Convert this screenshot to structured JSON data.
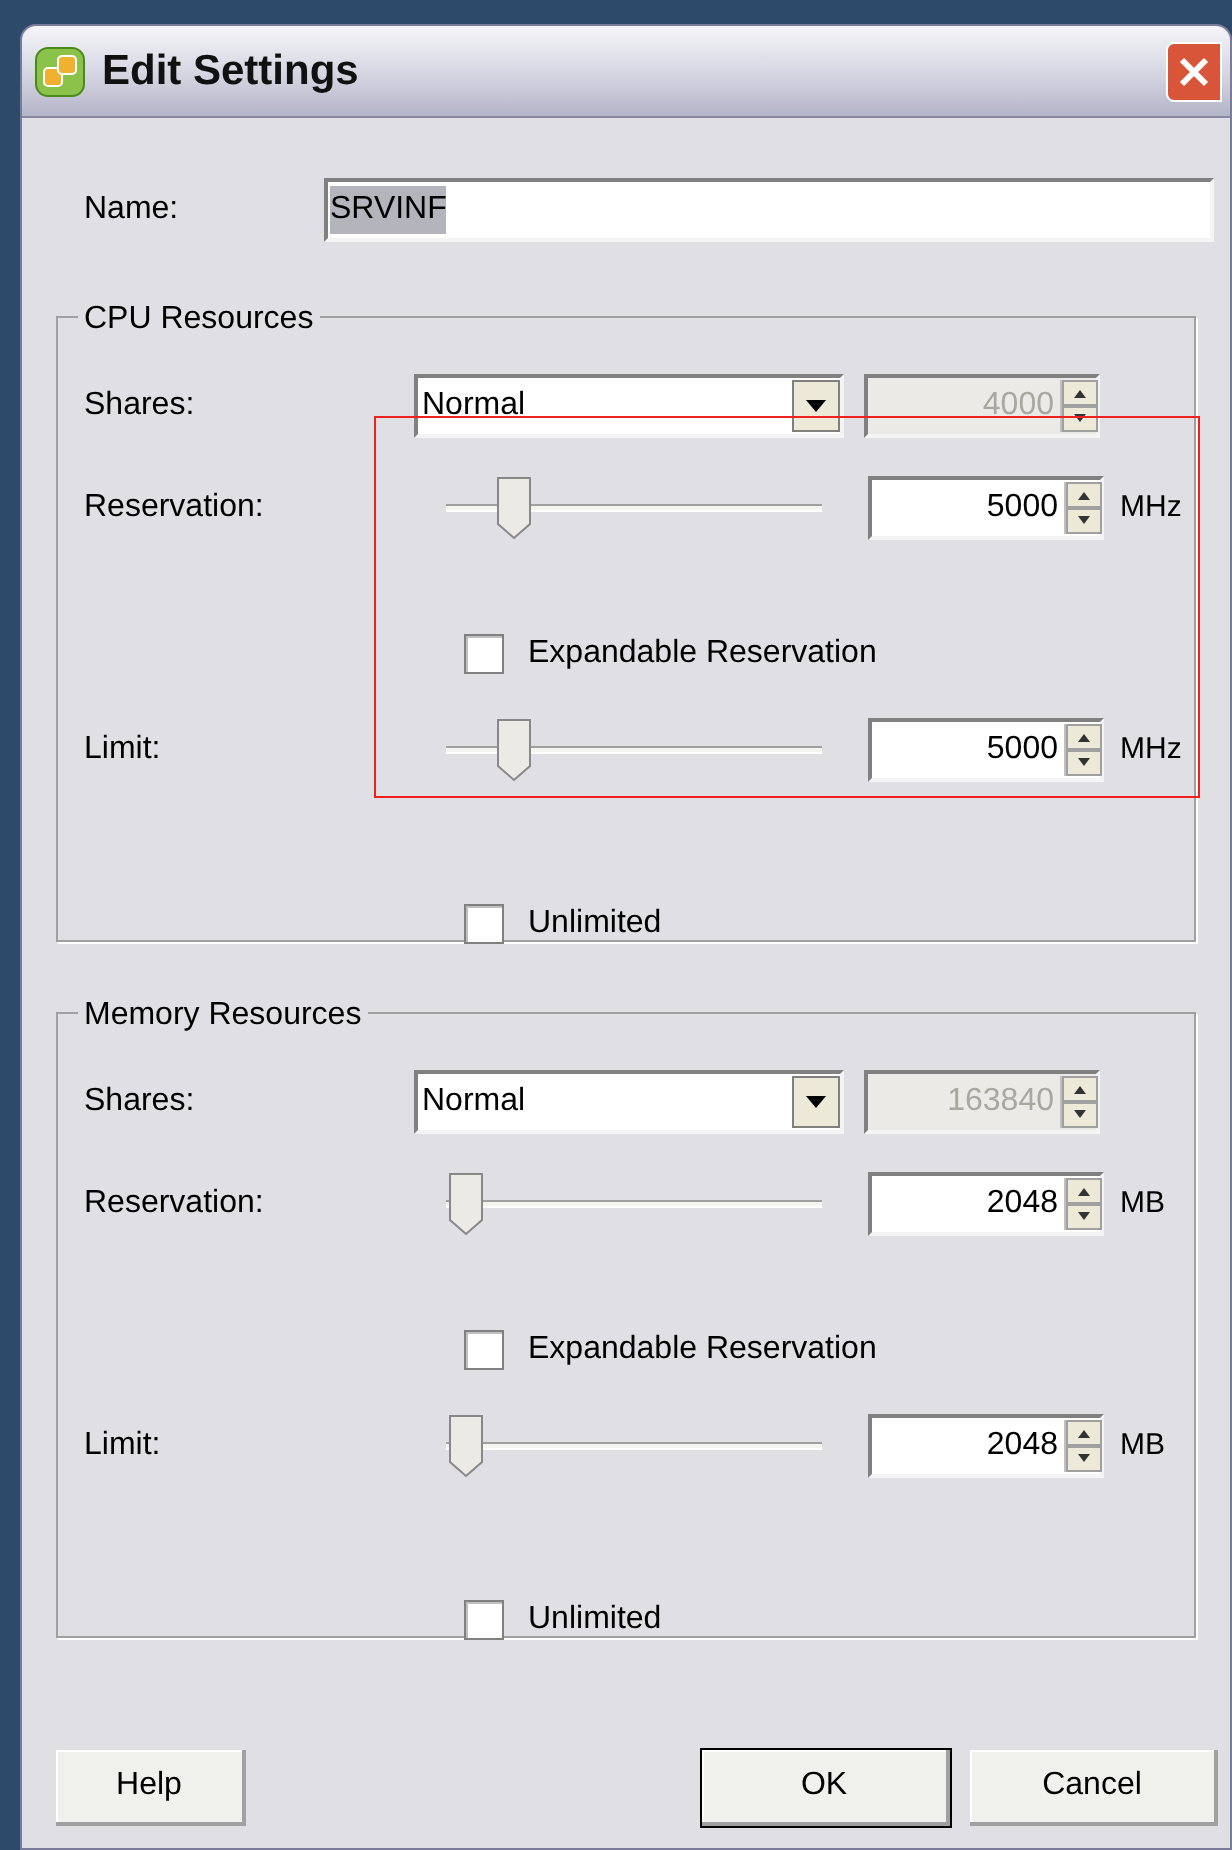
{
  "window": {
    "title": "Edit Settings"
  },
  "name": {
    "label": "Name:",
    "value": "SRVINF",
    "text_selected": true
  },
  "groups": [
    {
      "title": "CPU Resources",
      "shares": {
        "label": "Shares:",
        "value": "Normal",
        "amount": "4000",
        "disabled": true
      },
      "reservation": {
        "label": "Reservation:",
        "level": 0.18,
        "value": "5000",
        "unit": "MHz"
      },
      "expandable": {
        "label": "Expandable Reservation",
        "checked": false
      },
      "limit": {
        "label": "Limit:",
        "level": 0.18,
        "value": "5000",
        "unit": "MHz"
      },
      "unlimited": {
        "label": "Unlimited",
        "checked": false
      }
    },
    {
      "title": "Memory Resources",
      "shares": {
        "label": "Shares:",
        "value": "Normal",
        "amount": "163840",
        "disabled": true
      },
      "reservation": {
        "label": "Reservation:",
        "level": 0.05,
        "value": "2048",
        "unit": "MB"
      },
      "expandable": {
        "label": "Expandable Reservation",
        "checked": false
      },
      "limit": {
        "label": "Limit:",
        "level": 0.05,
        "value": "2048",
        "unit": "MB"
      },
      "unlimited": {
        "label": "Unlimited",
        "checked": false
      }
    }
  ],
  "buttons": [
    {
      "label": "Help",
      "default": false
    },
    {
      "label": "OK",
      "default": true
    },
    {
      "label": "Cancel",
      "default": false
    }
  ]
}
